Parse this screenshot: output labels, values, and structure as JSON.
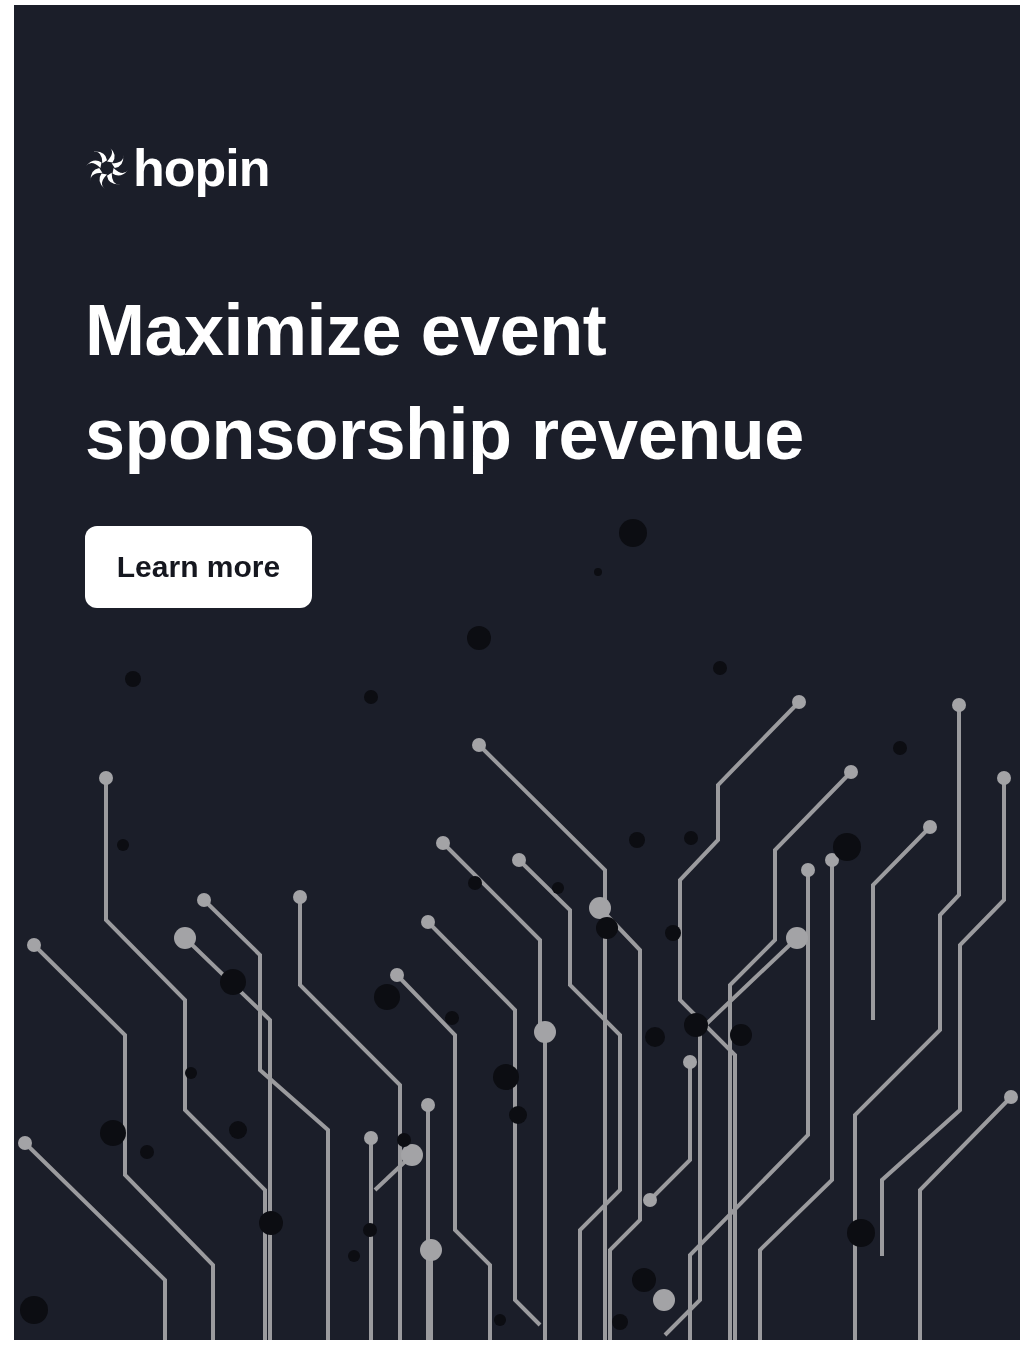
{
  "logo": {
    "text": "hopin"
  },
  "headline": "Maximize event sponsorship revenue",
  "button": {
    "label": "Learn more"
  }
}
